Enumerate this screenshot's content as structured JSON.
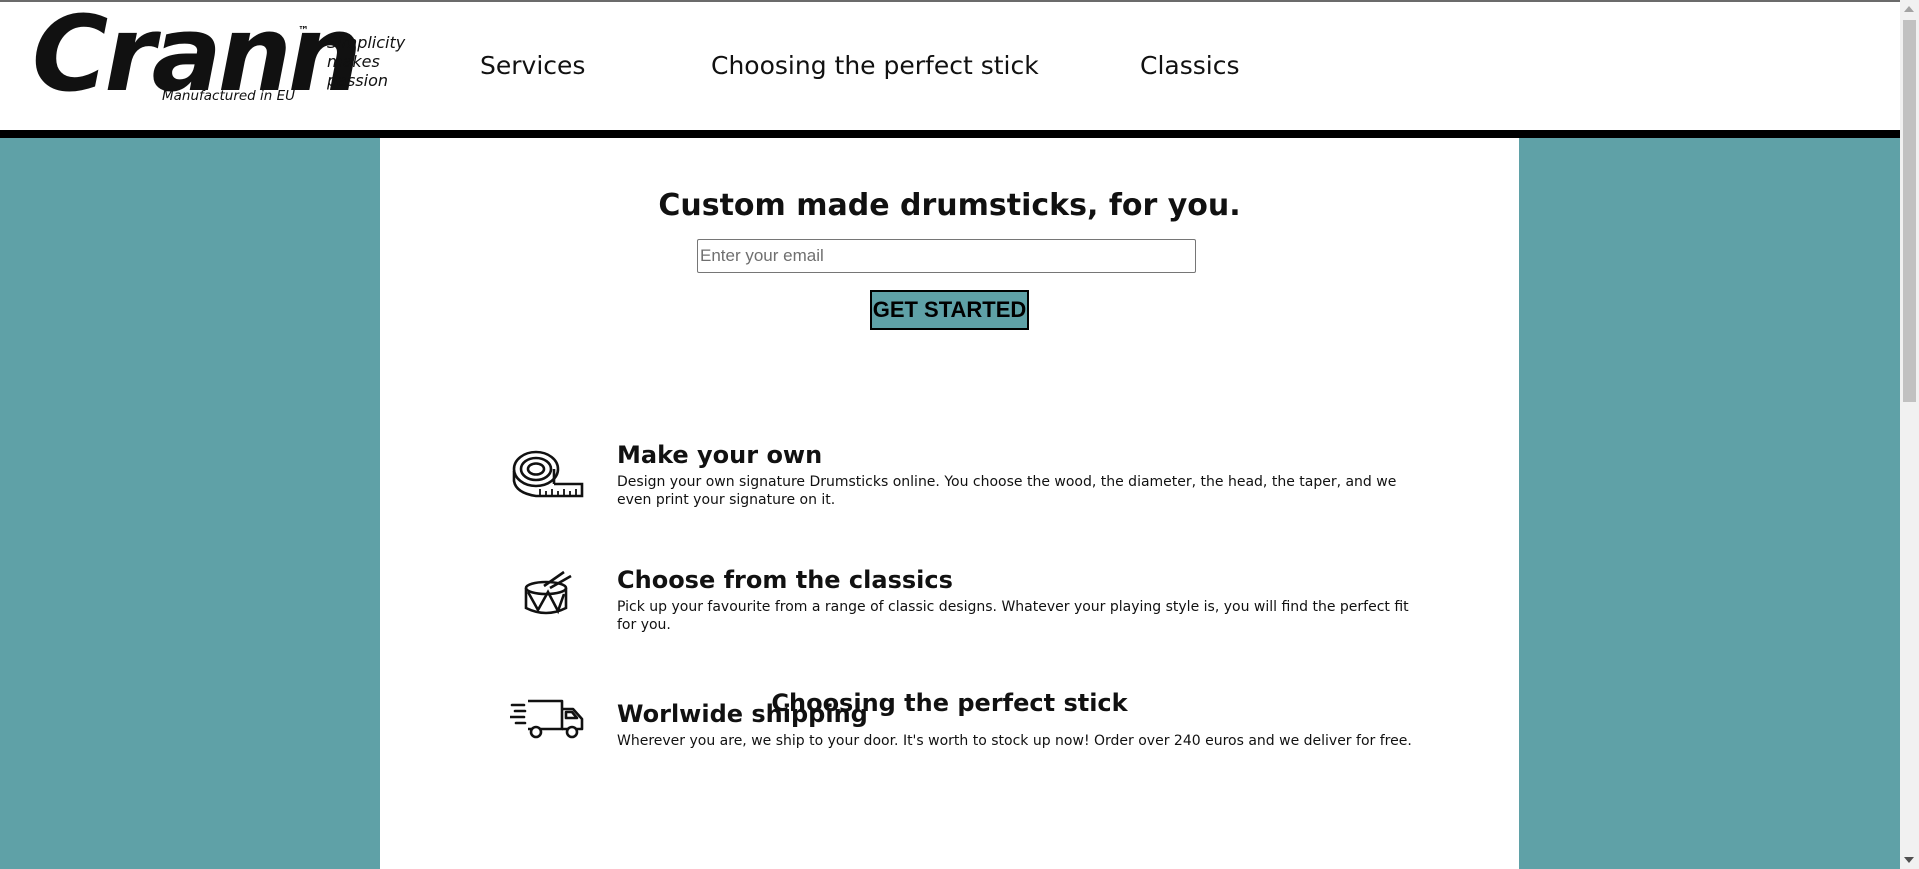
{
  "header": {
    "logo": {
      "wordmark": "Crann",
      "trademark": "™",
      "subtitle": "Manufactured in EU"
    },
    "tagline": [
      "Simplicity",
      "makes",
      "passion"
    ],
    "nav": [
      {
        "label": "Services"
      },
      {
        "label": "Choosing the perfect stick"
      },
      {
        "label": "Classics"
      }
    ]
  },
  "hero": {
    "title": "Custom made drumsticks, for you.",
    "email_placeholder": "Enter your email",
    "cta_label": "GET STARTED"
  },
  "features": [
    {
      "icon": "measuring-tape-icon",
      "title": "Make your own",
      "text": "Design your own signature Drumsticks online. You choose the wood, the diameter, the head, the taper, and we even print your signature on it."
    },
    {
      "icon": "drum-icon",
      "title": "Choose from the classics",
      "text": "Pick up your favourite from a range of classic designs. Whatever your playing style is, you will find the perfect fit for you."
    },
    {
      "icon": "delivery-truck-icon",
      "title": "Worlwide shipping",
      "text": "Wherever you are, we ship to your door. It's worth to stock up now! Order over 240 euros and we deliver for free."
    }
  ],
  "next_section": {
    "title": "Choosing the perfect stick"
  },
  "colors": {
    "background": "#5fa1a7",
    "accent": "#5fa1a7",
    "content_bg": "#ffffff",
    "header_border": "#000000"
  }
}
